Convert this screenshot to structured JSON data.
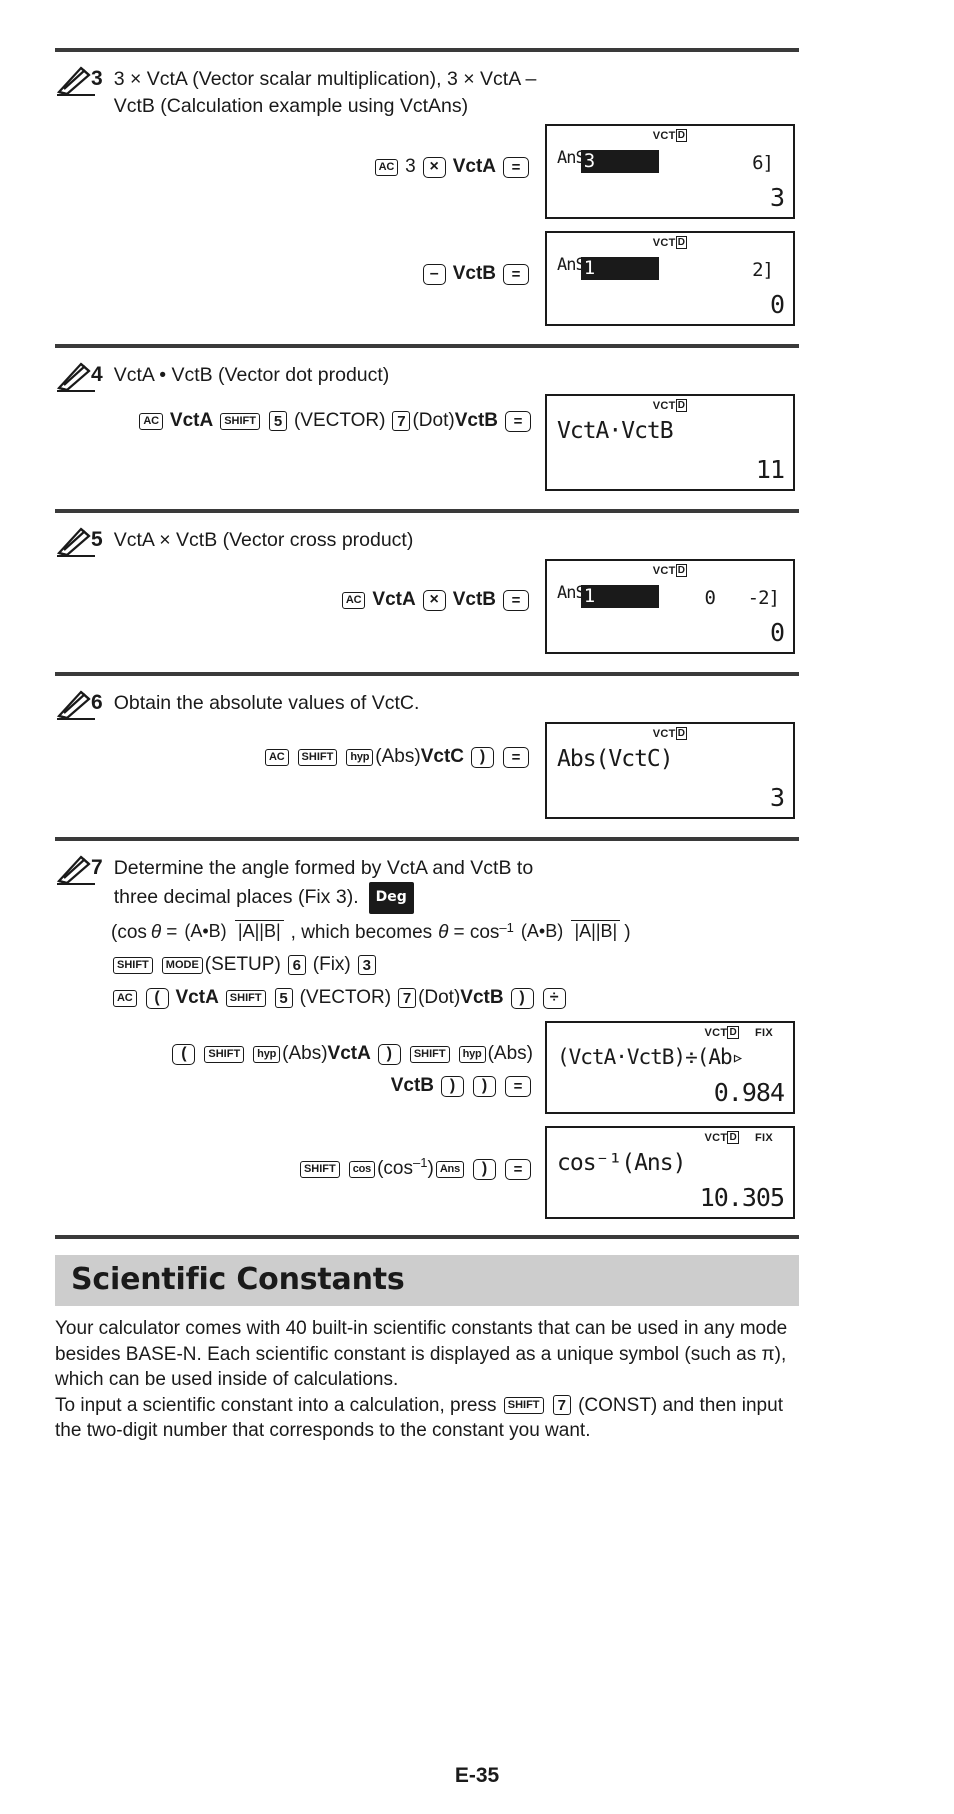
{
  "page": {
    "footer_label": "E-35"
  },
  "examples": [
    {
      "number": "3",
      "description": "3 × VctA (Vector scalar multiplication), 3 × VctA – VctB (Calculation example using VctAns)",
      "steps": [
        {
          "keys": [
            "AC",
            "3",
            "×",
            "VctA",
            "="
          ],
          "display": {
            "indicator": "VCT",
            "indicator_box": "D",
            "fix": "",
            "ans_label": "AnS",
            "inverted_cell": "3",
            "right_cell": "6]",
            "result": "3"
          }
        },
        {
          "keys": [
            "–",
            "VctB",
            "="
          ],
          "display": {
            "indicator": "VCT",
            "indicator_box": "D",
            "fix": "",
            "ans_label": "AnS",
            "inverted_cell": "1",
            "right_cell": "2]",
            "result": "0"
          }
        }
      ]
    },
    {
      "number": "4",
      "description": "VctA • VctB (Vector dot product)",
      "key_sequence_label": "AC VctA SHIFT 5 (VECTOR) 7 (Dot) VctB =",
      "display": {
        "indicator": "VCT",
        "indicator_box": "D",
        "fix": "",
        "expression": "VctA·VctB",
        "result": "11"
      }
    },
    {
      "number": "5",
      "description": "VctA × VctB (Vector cross product)",
      "key_sequence_label": "AC VctA × VctB =",
      "display": {
        "indicator": "VCT",
        "indicator_box": "D",
        "fix": "",
        "ans_label": "AnS",
        "inverted_cell": "1",
        "mid_cell": "0",
        "right_cell": "-2]",
        "result": "0"
      }
    },
    {
      "number": "6",
      "description": "Obtain the absolute values of VctC.",
      "key_sequence_label": "AC SHIFT hyp (Abs) VctC ) =",
      "display": {
        "indicator": "VCT",
        "indicator_box": "D",
        "fix": "",
        "expression": "Abs(VctC)",
        "result": "3"
      }
    },
    {
      "number": "7",
      "description": "Determine the angle formed by VctA and VctB to three decimal places (Fix 3).",
      "badge": "Deg",
      "formula_prefix": "(cos",
      "formula_theta": "θ",
      "formula_eq": "=",
      "frac1_num": "(A•B)",
      "frac1_den": "|A||B|",
      "formula_mid": ", which becomes",
      "formula_theta2": "θ",
      "formula_eq2": "= cos",
      "formula_exp": "–1",
      "frac2_num": "(A•B)",
      "frac2_den": "|A||B|",
      "formula_suffix": ")",
      "steps": [
        {
          "keys": [
            "SHIFT",
            "MODE",
            "(SETUP)",
            "6",
            "(Fix)",
            "3"
          ]
        },
        {
          "keys": [
            "AC",
            "(",
            "VctA",
            "SHIFT",
            "5",
            "(VECTOR)",
            "7",
            "(Dot)",
            "VctB",
            ")",
            "÷"
          ]
        },
        {
          "keys": [
            "(",
            "SHIFT",
            "hyp",
            "(Abs)",
            "VctA",
            ")",
            "SHIFT",
            "hyp",
            "(Abs)",
            "VctB",
            ")",
            ")",
            "="
          ],
          "display": {
            "indicator": "VCT",
            "indicator_box": "D",
            "fix": "FIX",
            "expression": "(VctA·VctB)÷(Ab▹",
            "result": "0.984"
          }
        },
        {
          "keys": [
            "SHIFT",
            "cos",
            "(cos–1)",
            "Ans",
            ")",
            "="
          ],
          "display": {
            "indicator": "VCT",
            "indicator_box": "D",
            "fix": "FIX",
            "expression": "cos⁻¹(Ans)",
            "result": "10.305"
          }
        }
      ]
    }
  ],
  "keys": {
    "ac": "AC",
    "shift": "SHIFT",
    "mode": "MODE",
    "hyp": "hyp",
    "cos": "cos",
    "ans": "Ans",
    "equals": "=",
    "multiply": "×",
    "minus": "–",
    "divide": "÷",
    "paren_open": "(",
    "paren_close": ")",
    "num3": "3",
    "num5": "5",
    "num6": "6",
    "num7": "7"
  },
  "labels": {
    "vcta": "VctA",
    "vctb": "VctB",
    "vctc": "VctC",
    "vector": "(VECTOR)",
    "dot": "(Dot)",
    "abs": "(Abs)",
    "setup": "(SETUP)",
    "fix": "(Fix)",
    "cos_inv": "(cos",
    "cos_inv_sup": "–1",
    "cos_inv_close": ")"
  },
  "scientific_constants": {
    "title": "Scientific Constants",
    "paragraph1": "Your calculator comes with 40 built-in scientific constants that can be used in any mode besides BASE-N. Each scientific constant is displayed as a unique symbol (such as π), which can be used inside of calculations.",
    "paragraph2_pre": "To input a scientific constant into a calculation, press",
    "paragraph2_key1": "SHIFT",
    "paragraph2_key2": "7",
    "paragraph2_mid": "(CONST) and",
    "paragraph2_post": "then input the two-digit number that corresponds to the constant you want."
  }
}
